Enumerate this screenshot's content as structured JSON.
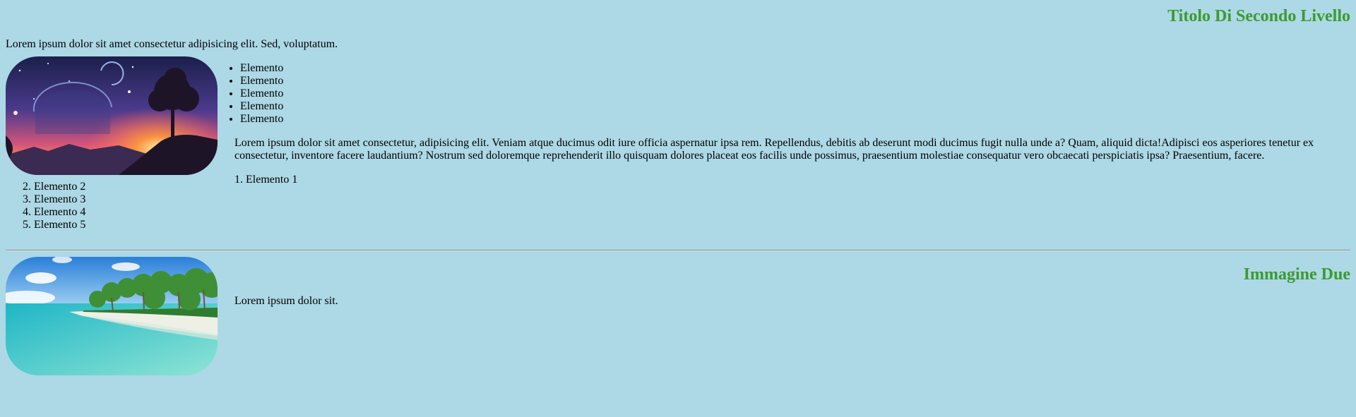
{
  "header": {
    "title": "Titolo Di Secondo Livello"
  },
  "intro_text": "Lorem ipsum dolor sit amet consectetur adipisicing elit. Sed, voluptatum.",
  "section1": {
    "image_alt": "space-landscape-image",
    "bullet_items": [
      "Elemento",
      "Elemento",
      "Elemento",
      "Elemento",
      "Elemento"
    ],
    "paragraph": "Lorem ipsum dolor sit amet consectetur, adipisicing elit. Veniam atque ducimus odit iure officia aspernatur ipsa rem. Repellendus, debitis ab deserunt modi ducimus fugit nulla unde a? Quam, aliquid dicta!Adipisci eos asperiores tenetur ex consectetur, inventore facere laudantium? Nostrum sed doloremque reprehenderit illo quisquam dolores placeat eos facilis unde possimus, praesentium molestiae consequatur vero obcaecati perspiciatis ipsa? Praesentium, facere.",
    "ordered_items": [
      "Elemento 1",
      "Elemento 2",
      "Elemento 3",
      "Elemento 4",
      "Elemento 5"
    ]
  },
  "section2": {
    "title": "Immagine Due",
    "image_alt": "tropical-beach-image",
    "paragraph": "Lorem ipsum dolor sit."
  },
  "colors": {
    "background": "#add8e6",
    "heading": "#3c9b2e"
  }
}
